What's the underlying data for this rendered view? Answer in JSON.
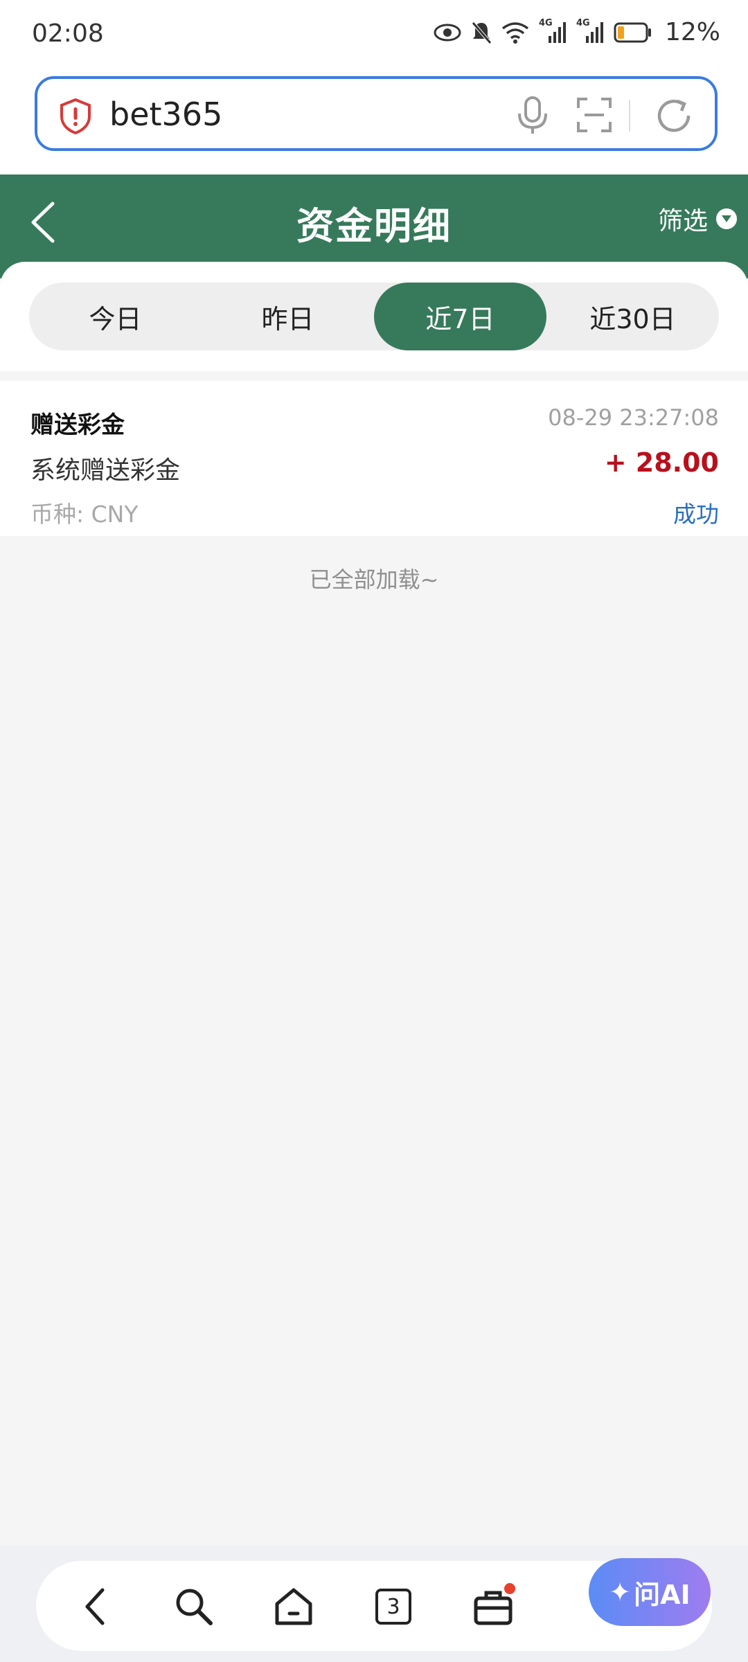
{
  "status_bar": {
    "time": "02:08",
    "battery": "12%",
    "network_label_1": "4G",
    "network_label_2": "4G"
  },
  "address_bar": {
    "url_text": "bet365"
  },
  "header": {
    "title": "资金明细",
    "filter_label": "筛选"
  },
  "tabs": [
    {
      "label": "今日",
      "active": false
    },
    {
      "label": "昨日",
      "active": false
    },
    {
      "label": "近7日",
      "active": true
    },
    {
      "label": "近30日",
      "active": false
    }
  ],
  "records": [
    {
      "type": "赠送彩金",
      "time": "08-29 23:27:08",
      "description": "系统赠送彩金",
      "amount": "+ 28.00",
      "currency": "币种: CNY",
      "status": "成功"
    }
  ],
  "list_end_text": "已全部加载~",
  "bottom_nav": {
    "tab_count": "3",
    "ai_label": "问AI"
  },
  "colors": {
    "brand_green": "#367a5b",
    "amount_red": "#b8101c",
    "status_blue": "#2a6fc0",
    "url_border": "#3a7be0"
  }
}
